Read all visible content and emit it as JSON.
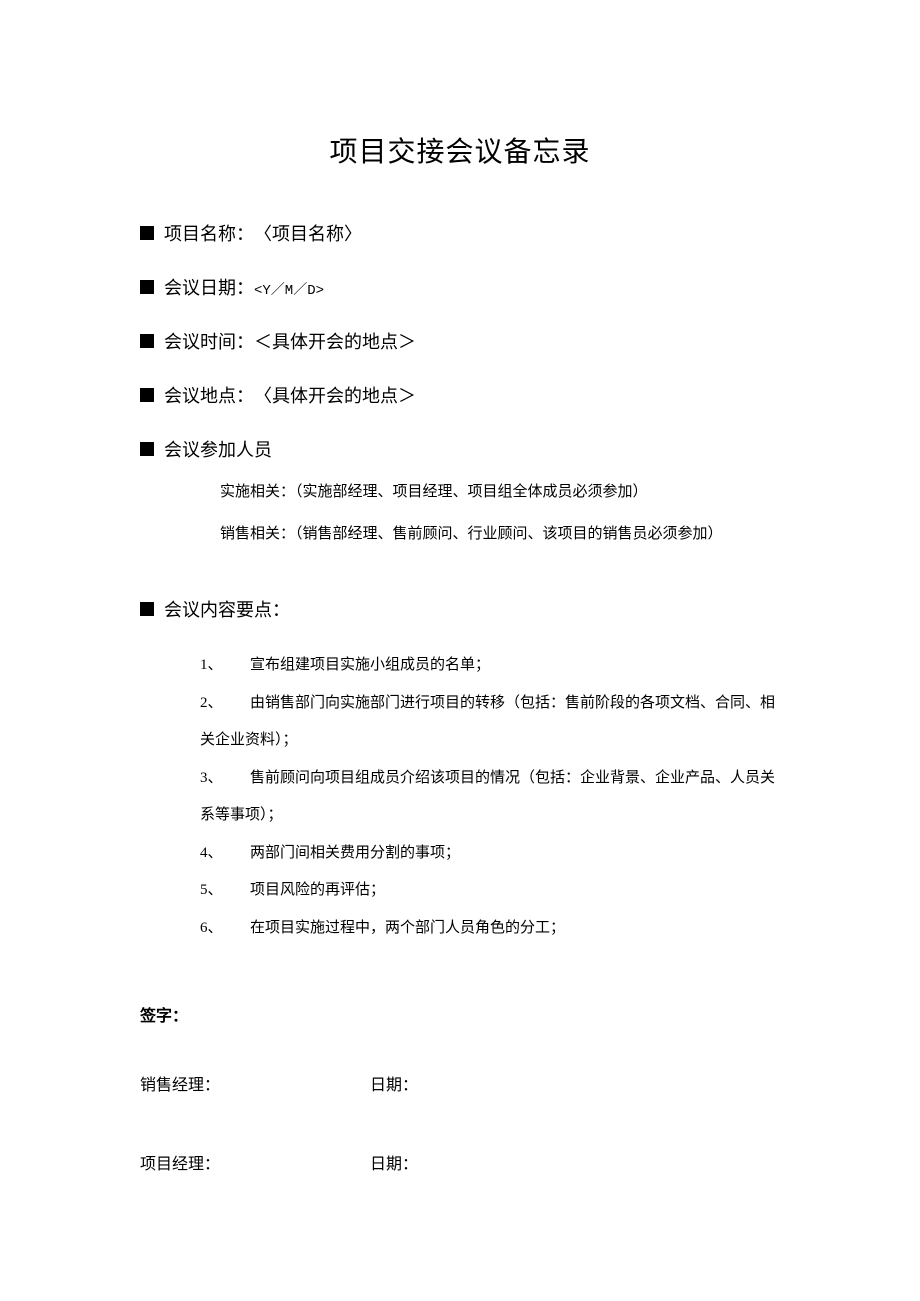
{
  "title": "项目交接会议备忘录",
  "fields": {
    "project_name": {
      "label": "项目名称：",
      "value": "〈项目名称〉"
    },
    "meeting_date": {
      "label": "会议日期：",
      "value": "<Y／M／D>"
    },
    "meeting_time": {
      "label": "会议时间：",
      "value": "＜具体开会的地点＞"
    },
    "meeting_location": {
      "label": "会议地点：",
      "value": "〈具体开会的地点＞"
    },
    "attendees": {
      "label": "会议参加人员",
      "lines": [
        "实施相关：（实施部经理、项目经理、项目组全体成员必须参加）",
        "销售相关：（销售部经理、售前顾问、行业顾问、该项目的销售员必须参加）"
      ]
    },
    "content": {
      "label": "会议内容要点：",
      "items": [
        {
          "num": "1、",
          "text": "宣布组建项目实施小组成员的名单；"
        },
        {
          "num": "2、",
          "text": "由销售部门向实施部门进行项目的转移（包括：售前阶段的各项文档、合同、相关企业资料）；"
        },
        {
          "num": "3、",
          "text": "售前顾问向项目组成员介绍该项目的情况（包括：企业背景、企业产品、人员关系等事项）；"
        },
        {
          "num": "4、",
          "text": "两部门间相关费用分割的事项；"
        },
        {
          "num": "5、",
          "text": "项目风险的再评估；"
        },
        {
          "num": "6、",
          "text": "在项目实施过程中，两个部门人员角色的分工；"
        }
      ]
    }
  },
  "signature": {
    "label": "签字：",
    "rows": [
      {
        "role": "销售经理：",
        "date_label": "日期："
      },
      {
        "role": "项目经理：",
        "date_label": "日期："
      }
    ]
  }
}
